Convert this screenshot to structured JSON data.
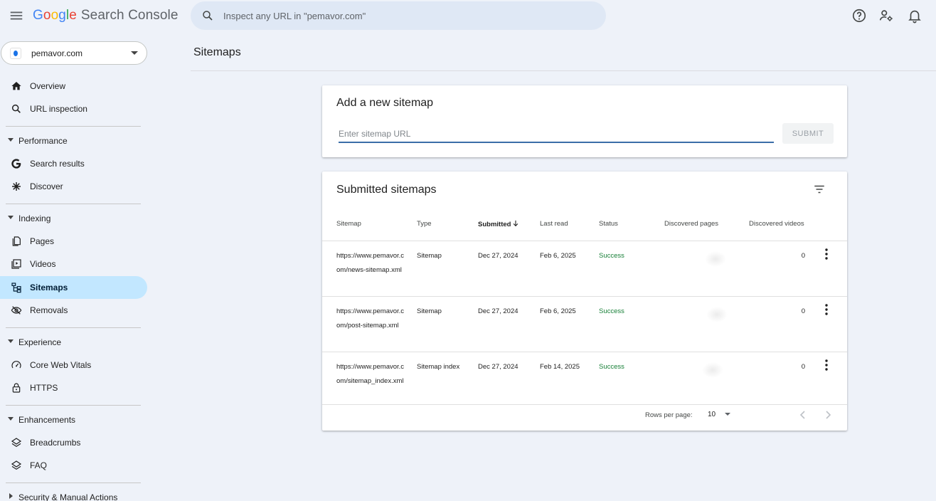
{
  "app": {
    "logo_letters": [
      "G",
      "o",
      "o",
      "g",
      "l",
      "e"
    ],
    "logo_suffix": "Search Console"
  },
  "search": {
    "placeholder": "Inspect any URL in \"pemavor.com\""
  },
  "property": {
    "name": "pemavor.com"
  },
  "sidebar": {
    "items": [
      {
        "label": "Overview"
      },
      {
        "label": "URL inspection"
      }
    ],
    "sections": [
      {
        "label": "Performance",
        "items": [
          {
            "label": "Search results"
          },
          {
            "label": "Discover"
          }
        ]
      },
      {
        "label": "Indexing",
        "items": [
          {
            "label": "Pages"
          },
          {
            "label": "Videos"
          },
          {
            "label": "Sitemaps"
          },
          {
            "label": "Removals"
          }
        ]
      },
      {
        "label": "Experience",
        "items": [
          {
            "label": "Core Web Vitals"
          },
          {
            "label": "HTTPS"
          }
        ]
      },
      {
        "label": "Enhancements",
        "items": [
          {
            "label": "Breadcrumbs"
          },
          {
            "label": "FAQ"
          }
        ]
      },
      {
        "label": "Security & Manual Actions",
        "items": []
      }
    ],
    "active": "Sitemaps"
  },
  "main": {
    "title": "Sitemaps",
    "add_card": {
      "title": "Add a new sitemap",
      "input_placeholder": "Enter sitemap URL",
      "submit_label": "SUBMIT"
    },
    "submitted_card": {
      "title": "Submitted sitemaps",
      "columns": {
        "sitemap": "Sitemap",
        "type": "Type",
        "submitted": "Submitted",
        "last_read": "Last read",
        "status": "Status",
        "discovered_pages": "Discovered pages",
        "discovered_videos": "Discovered videos"
      },
      "rows": [
        {
          "sitemap": "https://www.pemavor.com/news-sitemap.xml",
          "type": "Sitemap",
          "submitted": "Dec 27, 2024",
          "last_read": "Feb 6, 2025",
          "status": "Success",
          "discovered_videos": "0"
        },
        {
          "sitemap": "https://www.pemavor.com/post-sitemap.xml",
          "type": "Sitemap",
          "submitted": "Dec 27, 2024",
          "last_read": "Feb 6, 2025",
          "status": "Success",
          "discovered_videos": "0"
        },
        {
          "sitemap": "https://www.pemavor.com/sitemap_index.xml",
          "type": "Sitemap index",
          "submitted": "Dec 27, 2024",
          "last_read": "Feb 14, 2025",
          "status": "Success",
          "discovered_videos": "0"
        }
      ],
      "footer": {
        "rows_per_page_label": "Rows per page:",
        "rows_per_page_value": "10"
      }
    }
  },
  "colors": {
    "active_nav": "#c2e7ff",
    "success": "#188038",
    "background": "#eef2f9"
  }
}
